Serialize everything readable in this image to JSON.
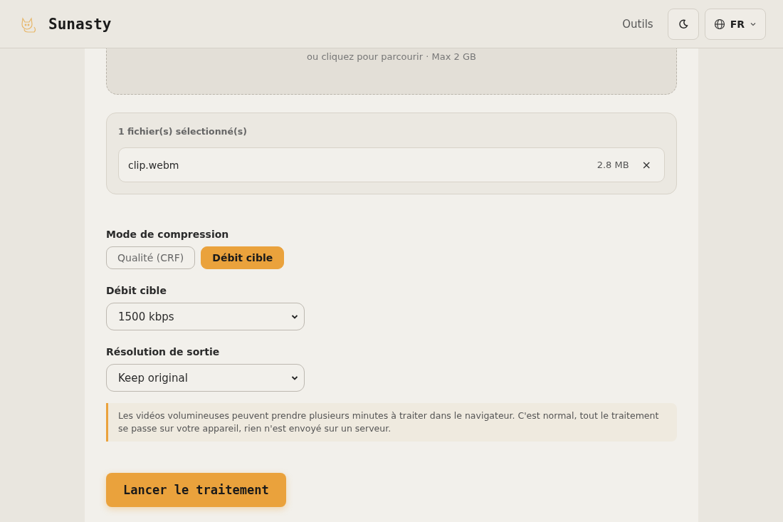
{
  "header": {
    "brand": "Sunasty",
    "nav_link": "Outils",
    "language": "FR"
  },
  "dropzone": {
    "hint": "ou cliquez pour parcourir · Max 2 GB"
  },
  "files": {
    "title": "1 fichier(s) sélectionné(s)",
    "items": [
      {
        "name": "clip.webm",
        "size": "2.8 MB",
        "remove": "×"
      }
    ]
  },
  "mode": {
    "label": "Mode de compression",
    "options": [
      {
        "label": "Qualité (CRF)",
        "selected": false
      },
      {
        "label": "Débit cible",
        "selected": true
      }
    ]
  },
  "fields": [
    {
      "label": "Débit cible",
      "value": "1500 kbps"
    },
    {
      "label": "Résolution de sortie",
      "value": "Keep original"
    }
  ],
  "notice": "Les vidéos volumineuses peuvent prendre plusieurs minutes à traiter dans le navigateur. C'est normal, tout le traitement se passe sur votre appareil, rien n'est envoyé sur un serveur.",
  "submit": "Lancer le traitement"
}
